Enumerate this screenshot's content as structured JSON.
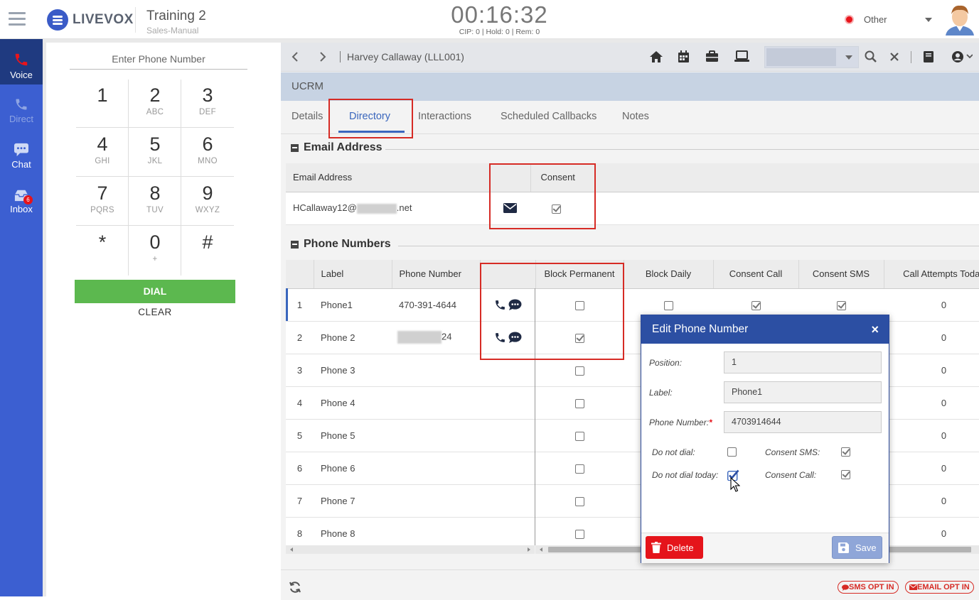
{
  "app": {
    "brand": "LIVEVOX",
    "accent": "#3c5fd1"
  },
  "campaign": {
    "title": "Training 2",
    "subtitle": "Sales-Manual"
  },
  "timer": {
    "clock": "00:16:32",
    "stats": "CIP: 0 | Hold: 0 | Rem: 0"
  },
  "agent_status": {
    "label": "Other",
    "color": "#e8141b"
  },
  "leftnav": [
    {
      "label": "Voice",
      "icon": "phone-icon",
      "active": true
    },
    {
      "label": "Direct",
      "icon": "phone-icon",
      "disabled": true
    },
    {
      "label": "Chat",
      "icon": "chat-icon"
    },
    {
      "label": "Inbox",
      "icon": "inbox-icon",
      "badge": "6"
    }
  ],
  "dialpad": {
    "prompt": "Enter Phone Number",
    "keys": [
      {
        "n": "1",
        "l": ""
      },
      {
        "n": "2",
        "l": "ABC"
      },
      {
        "n": "3",
        "l": "DEF"
      },
      {
        "n": "4",
        "l": "GHI"
      },
      {
        "n": "5",
        "l": "JKL"
      },
      {
        "n": "6",
        "l": "MNO"
      },
      {
        "n": "7",
        "l": "PQRS"
      },
      {
        "n": "8",
        "l": "TUV"
      },
      {
        "n": "9",
        "l": "WXYZ"
      },
      {
        "n": "*",
        "l": ""
      },
      {
        "n": "0",
        "l": "+"
      },
      {
        "n": "#",
        "l": ""
      }
    ],
    "dial": "DIAL",
    "clear": "CLEAR"
  },
  "navbar": {
    "customer": "Harvey Callaway (LLL001)"
  },
  "ucrm": {
    "title": "UCRM"
  },
  "tabs": [
    "Details",
    "Directory",
    "Interactions",
    "Scheduled Callbacks",
    "Notes"
  ],
  "email_section": {
    "title": "Email Address",
    "headers": [
      "Email Address",
      "",
      "Consent"
    ],
    "row": {
      "prefix": "HCallaway12@",
      "suffix": ".net",
      "consent": true
    }
  },
  "phone_section": {
    "title": "Phone Numbers",
    "headers": [
      "",
      "Label",
      "Phone Number",
      "",
      "Block Permanent",
      "Block Daily",
      "Consent Call",
      "Consent SMS",
      "Call Attempts Today"
    ],
    "rows": [
      {
        "idx": "1",
        "label": "Phone1",
        "number": "470-391-4644",
        "actions": true,
        "block_perm": false,
        "block_daily": false,
        "consent_call": true,
        "consent_sms": true,
        "attempts": "0"
      },
      {
        "idx": "2",
        "label": "Phone 2",
        "number": "24",
        "masked": true,
        "actions": true,
        "block_perm": true,
        "attempts": "0"
      },
      {
        "idx": "3",
        "label": "Phone 3",
        "number": "",
        "block_perm": false,
        "attempts": "0"
      },
      {
        "idx": "4",
        "label": "Phone 4",
        "number": "",
        "block_perm": false,
        "attempts": "0"
      },
      {
        "idx": "5",
        "label": "Phone 5",
        "number": "",
        "block_perm": false,
        "attempts": "0"
      },
      {
        "idx": "6",
        "label": "Phone 6",
        "number": "",
        "block_perm": false,
        "attempts": "0"
      },
      {
        "idx": "7",
        "label": "Phone 7",
        "number": "",
        "block_perm": false,
        "attempts": "0"
      },
      {
        "idx": "8",
        "label": "Phone 8",
        "number": "",
        "block_perm": false,
        "attempts": "0"
      }
    ]
  },
  "modal": {
    "title": "Edit Phone Number",
    "close": "×",
    "position_label": "Position:",
    "position_value": "1",
    "label_label": "Label:",
    "label_value": "Phone1",
    "number_label": "Phone Number:",
    "required_mark": "*",
    "number_value": "4703914644",
    "do_not_dial": {
      "label": "Do not dial:",
      "checked": false
    },
    "do_not_dial_today": {
      "label": "Do not dial today:",
      "checked": true
    },
    "consent_sms": {
      "label": "Consent SMS:",
      "checked": true
    },
    "consent_call": {
      "label": "Consent Call:",
      "checked": true
    },
    "delete": "Delete",
    "save": "Save"
  },
  "footer": {
    "sms_opt_in": "SMS OPT IN",
    "email_opt_in": "EMAIL OPT IN"
  }
}
